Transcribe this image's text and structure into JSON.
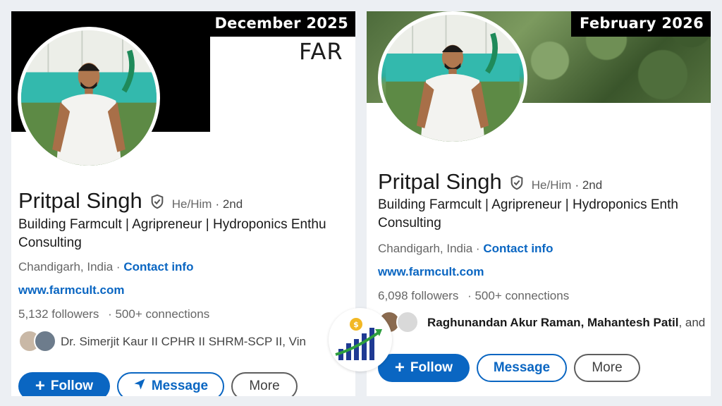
{
  "left": {
    "date_label": "December 2025",
    "banner_wordmark": "FAR",
    "name": "Pritpal Singh",
    "pronouns": "He/Him",
    "degree": "· 2nd",
    "headline_line1": "Building Farmcult | Agripreneur | Hydroponics Enthu",
    "headline_line2": "Consulting",
    "location": "Chandigarh, India ·",
    "contact_info": "Contact info",
    "website": "www.farmcult.com",
    "followers": "5,132 followers",
    "connections": "· 500+ connections",
    "mutual_connections": "Dr. Simerjit Kaur II CPHR II SHRM-SCP II, Vin",
    "follow_label": "Follow",
    "message_label": "Message",
    "more_label": "More"
  },
  "right": {
    "date_label": "February 2026",
    "name": "Pritpal Singh",
    "pronouns": "He/Him",
    "degree": "· 2nd",
    "headline_line1": "Building Farmcult | Agripreneur | Hydroponics Enth",
    "headline_line2": "Consulting",
    "location": "Chandigarh, India ·",
    "contact_info": "Contact info",
    "website": "www.farmcult.com",
    "followers": "6,098 followers",
    "connections": "· 500+ connections",
    "mutual_connections_bold": "Raghunandan Akur Raman, Mahantesh Patil",
    "mutual_connections_tail": ", and",
    "follow_label": "Follow",
    "message_label": "Message",
    "more_label": "More"
  },
  "colors": {
    "accent": "#0a66c2",
    "growth_bars": "#1f3a93",
    "growth_arrow": "#2e9e3e",
    "coin": "#f2b824"
  },
  "icons": [
    "verified-shield-icon",
    "plus-icon",
    "send-icon",
    "growth-chart-icon",
    "coin-icon"
  ]
}
